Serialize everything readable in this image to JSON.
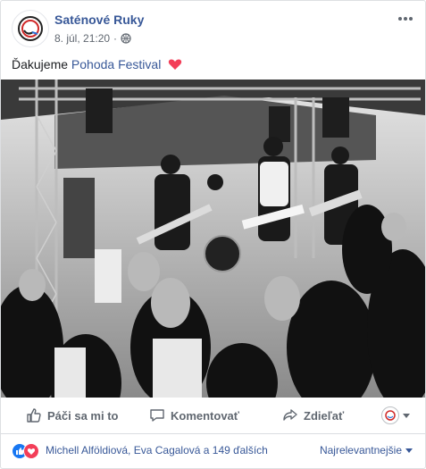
{
  "post": {
    "page_name": "Saténové Ruky",
    "timestamp": "8. júl, 21:20",
    "separator": "·",
    "privacy_icon": "globe-icon",
    "menu_icon": "more-horizontal-icon"
  },
  "text": {
    "prefix": "Ďakujeme",
    "tag": "Pohoda Festival",
    "emoji": "heart-icon"
  },
  "photo": {
    "style": "black-and-white",
    "subject": "band on stage with crowd"
  },
  "actions": {
    "like": "Páči sa mi to",
    "comment": "Komentovať",
    "share": "Zdieľať"
  },
  "footer": {
    "reactors": "Michell Alföldiová, Eva Cagalová a 149 ďalších",
    "sort": "Najrelevantnejšie"
  },
  "colors": {
    "link": "#385898",
    "like": "#1877f2",
    "love": "#f33e58",
    "muted": "#606770"
  }
}
